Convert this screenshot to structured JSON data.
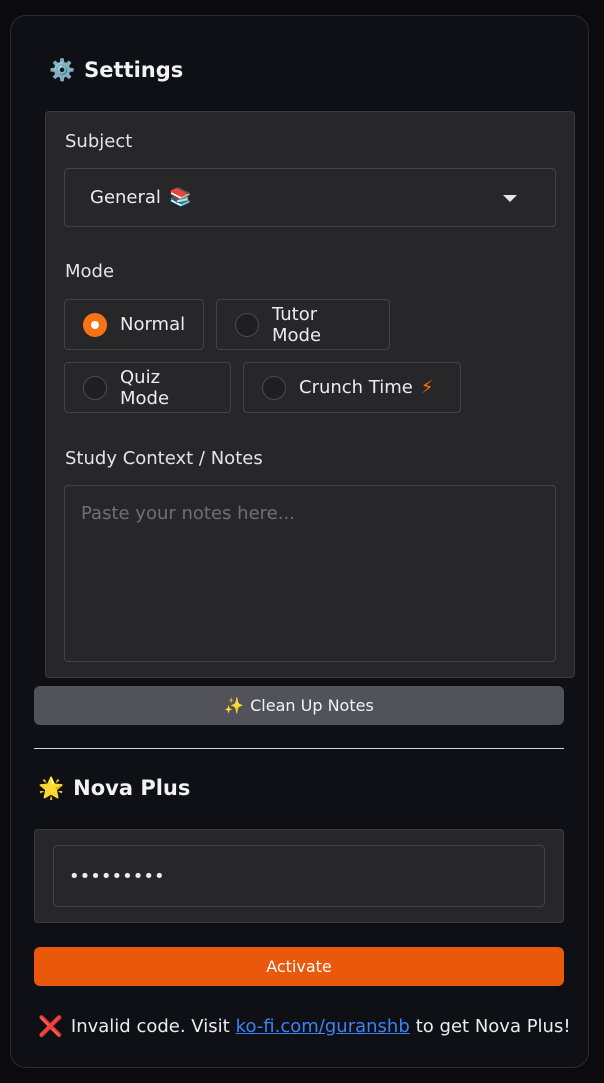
{
  "settings": {
    "title": "Settings",
    "title_icon": "⚙️",
    "subject": {
      "label": "Subject",
      "selected": "General",
      "selected_emoji": "📚"
    },
    "mode": {
      "label": "Mode",
      "options": [
        {
          "label": "Normal",
          "selected": true
        },
        {
          "label": "Tutor Mode",
          "selected": false
        },
        {
          "label": "Quiz Mode",
          "selected": false
        },
        {
          "label": "Crunch Time",
          "selected": false,
          "suffix": "⚡"
        }
      ]
    },
    "notes": {
      "label": "Study Context / Notes",
      "value": "",
      "placeholder": "Paste your notes here..."
    },
    "clean_button": {
      "icon": "✨",
      "label": "Clean Up Notes"
    }
  },
  "nova": {
    "title": "Nova Plus",
    "title_icon": "🌟",
    "code_value": "•••••••••",
    "activate_label": "Activate",
    "message": {
      "icon": "❌",
      "prefix": "Invalid code. Visit",
      "link_text": "ko-fi.com/guranshb",
      "suffix": "to get Nova Plus!"
    }
  },
  "colors": {
    "accent": "#f97316",
    "activate": "#ea580c",
    "link": "#3b82f6",
    "error": "#f43f5e"
  }
}
